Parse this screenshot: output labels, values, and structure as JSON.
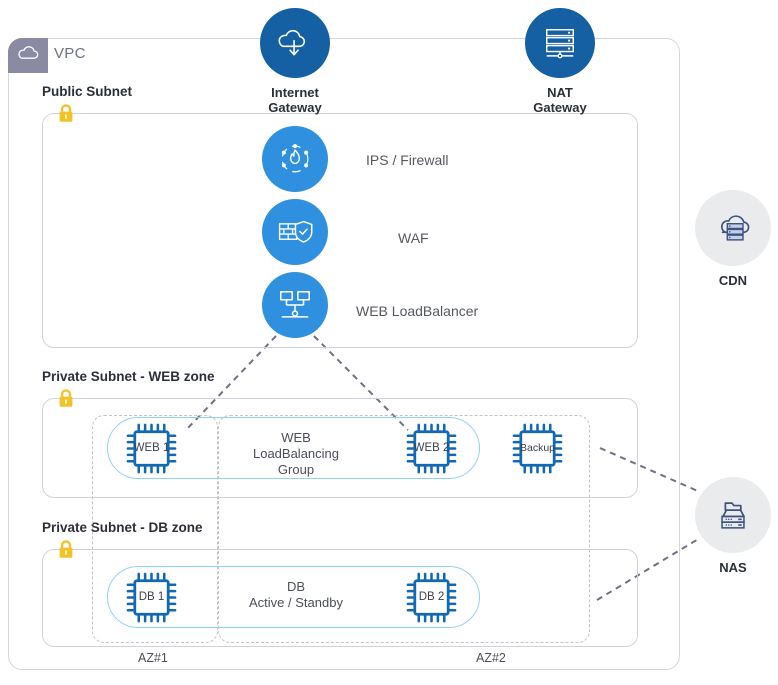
{
  "diagram": {
    "title": "AWS-style VPC network architecture",
    "vpc": {
      "label": "VPC",
      "icon": "cloud-icon"
    }
  },
  "subnets": [
    {
      "id": "public",
      "title": "Public Subnet",
      "lock_icon": "lock-icon"
    },
    {
      "id": "web",
      "title": "Private Subnet - WEB zone",
      "lock_icon": "lock-icon"
    },
    {
      "id": "db",
      "title": "Private Subnet - DB zone",
      "lock_icon": "lock-icon"
    }
  ],
  "gateways": [
    {
      "id": "igw",
      "label": "Internet\nGateway",
      "icon": "cloud-download-icon",
      "color": "#1460a3"
    },
    {
      "id": "nat",
      "label": "NAT\nGateway",
      "icon": "server-rack-icon",
      "color": "#1460a3"
    }
  ],
  "public_services": [
    {
      "id": "ips",
      "label": "IPS / Firewall",
      "icon": "firewall-flame-icon",
      "color": "#2f90e0"
    },
    {
      "id": "waf",
      "label": "WAF",
      "icon": "brick-shield-icon",
      "color": "#2f90e0"
    },
    {
      "id": "elb",
      "label": "WEB LoadBalancer",
      "icon": "load-balancer-icon",
      "color": "#2f90e0"
    }
  ],
  "external": [
    {
      "id": "cdn",
      "label": "CDN",
      "icon": "cloud-server-icon",
      "color": "#eaebec"
    },
    {
      "id": "nas",
      "label": "NAS",
      "icon": "nas-folder-icon",
      "color": "#eaebec"
    }
  ],
  "availability_zones": [
    {
      "id": "az1",
      "label": "AZ#1"
    },
    {
      "id": "az2",
      "label": "AZ#2"
    }
  ],
  "web_zone": {
    "group_label": "WEB\nLoadBalancing\nGroup",
    "instances": [
      {
        "id": "web1",
        "label": "WEB 1",
        "icon": "cpu-chip-icon",
        "in_group": true
      },
      {
        "id": "web2",
        "label": "WEB 2",
        "icon": "cpu-chip-icon",
        "in_group": true
      },
      {
        "id": "backup",
        "label": "Backup",
        "icon": "cpu-chip-icon",
        "in_group": false
      }
    ]
  },
  "db_zone": {
    "group_label": "DB\nActive / Standby",
    "instances": [
      {
        "id": "db1",
        "label": "DB 1",
        "icon": "cpu-chip-icon",
        "in_group": true
      },
      {
        "id": "db2",
        "label": "DB 2",
        "icon": "cpu-chip-icon",
        "in_group": true
      }
    ]
  },
  "colors": {
    "gateway_blue": "#1460a3",
    "service_blue": "#2f90e0",
    "chip_blue": "#1268b3",
    "group_outline": "#8fd2f5",
    "vpc_badge": "#8a8aa2",
    "lock_gold": "#f2c329",
    "connector": "#6f7183",
    "box_border": "#cfd2d8",
    "external_gray": "#eaebec",
    "icon_navy": "#3d5280"
  },
  "connections": [
    {
      "from": "elb",
      "to": "web1"
    },
    {
      "from": "elb",
      "to": "web2"
    },
    {
      "from": "backup",
      "to": "nas"
    },
    {
      "from": "db2",
      "to": "nas"
    }
  ]
}
